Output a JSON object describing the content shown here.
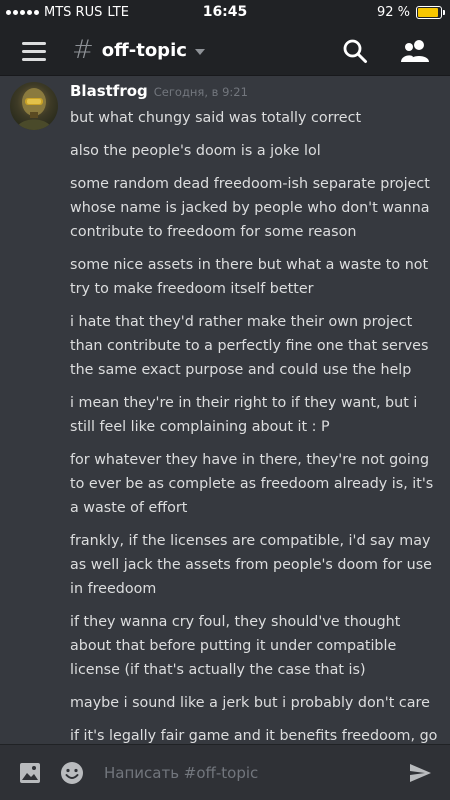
{
  "status_bar": {
    "carrier": "MTS RUS",
    "network": "LTE",
    "time": "16:45",
    "battery_text": "92 %",
    "battery_level": 0.92
  },
  "header": {
    "channel_hash": "#",
    "channel_name": "off-topic"
  },
  "message_group": {
    "author": "Blastfrog",
    "timestamp": "Сегодня, в 9:21",
    "messages": [
      "but what chungy said was totally correct",
      "also the people's doom is a joke lol",
      "some random dead freedoom-ish separate project whose name is jacked by people who don't wanna contribute to freedoom for some reason",
      "some nice assets in there but what a waste to not try to make freedoom itself better",
      "i hate that they'd rather make their own project than contribute to a perfectly fine one that serves the same exact purpose and could use the help",
      "i mean they're in their right to if they want, but i still feel like complaining about it  : P",
      "for whatever they have in there, they're not going to ever be as complete as freedoom already is, it's a waste of effort",
      "frankly, if the licenses are compatible, i'd say may as well jack the assets from people's doom for use in freedoom",
      "if they wanna cry foul, they should've thought about that before putting it under compatible license (if that's actually the case that is)",
      "maybe i sound like a jerk but i probably don't care",
      "if it's legally fair game and it benefits freedoom, go for it"
    ]
  },
  "composer": {
    "placeholder": "Написать #off-topic"
  },
  "colors": {
    "background": "#36393f",
    "header": "#202225",
    "composer": "#2f3136",
    "text": "#dcddde",
    "muted": "#72767d",
    "battery": "#f7c600"
  }
}
